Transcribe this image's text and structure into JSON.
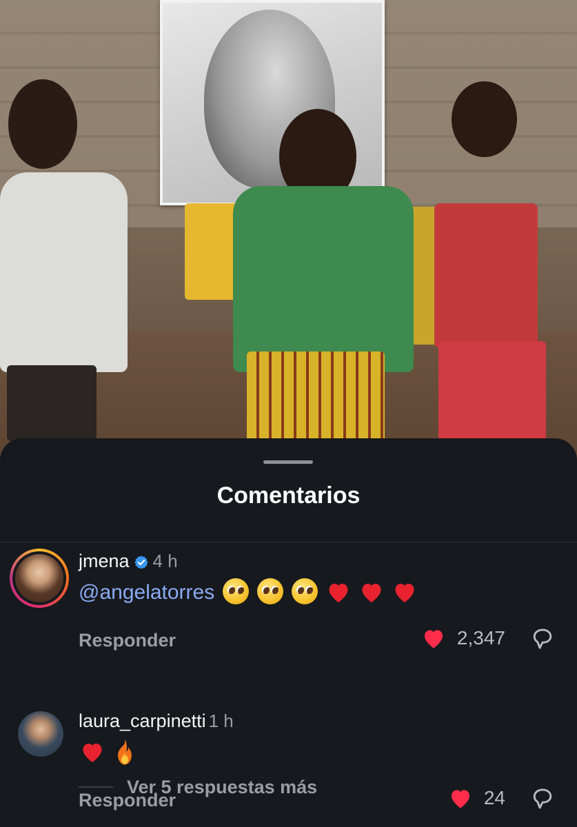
{
  "sheet": {
    "title": "Comentarios"
  },
  "comments": [
    {
      "username": "jmena",
      "verified": true,
      "time": "4 h",
      "mention": "@angelatorres",
      "emojis": [
        "pleading-face",
        "pleading-face",
        "pleading-face",
        "red-heart",
        "red-heart",
        "red-heart"
      ],
      "reply_label": "Responder",
      "likes": "2,347",
      "liked": true,
      "more_replies": "Ver 5 respuestas más"
    },
    {
      "username": "laura_carpinetti",
      "verified": false,
      "time": "1 h",
      "emojis": [
        "red-heart",
        "fire"
      ],
      "reply_label": "Responder",
      "likes": "24",
      "liked": true
    }
  ],
  "colors": {
    "sheet_bg": "#16191d",
    "text_primary": "#f5f5f5",
    "text_secondary": "#9a9da2",
    "mention": "#8aaaf5",
    "like_red": "#ff2d4b",
    "verified_blue": "#3897f0"
  }
}
